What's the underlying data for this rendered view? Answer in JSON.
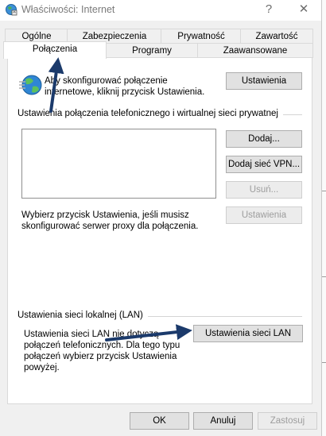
{
  "window": {
    "title": "Właściwości: Internet",
    "help_glyph": "?",
    "close_glyph": "✕"
  },
  "tabs": {
    "row1": [
      "Ogólne",
      "Zabezpieczenia",
      "Prywatność",
      "Zawartość"
    ],
    "row2": [
      "Połączenia",
      "Programy",
      "Zaawansowane"
    ],
    "active": "Połączenia"
  },
  "setup": {
    "text_line1": "Aby skonfigurować połączenie",
    "text_line2": "internetowe, kliknij przycisk Ustawienia.",
    "button": "Ustawienia"
  },
  "dialup": {
    "heading": "Ustawienia połączenia telefonicznego i wirtualnej sieci prywatnej",
    "add_button": "Dodaj...",
    "add_vpn_button": "Dodaj sieć VPN...",
    "remove_button": "Usuń...",
    "settings_button": "Ustawienia",
    "proxy_line1": "Wybierz przycisk Ustawienia, jeśli musisz",
    "proxy_line2": "skonfigurować serwer proxy dla połączenia."
  },
  "lan": {
    "heading": "Ustawienia sieci lokalnej (LAN)",
    "text_line1": "Ustawienia sieci LAN nie dotyczą",
    "text_line2": "połączeń telefonicznych. Dla tego typu",
    "text_line3": "połączeń wybierz przycisk Ustawienia",
    "text_line4": "powyżej.",
    "button": "Ustawienia sieci LAN"
  },
  "footer": {
    "ok": "OK",
    "cancel": "Anuluj",
    "apply": "Zastosuj"
  },
  "colors": {
    "arrow": "#1b3a6b",
    "window_bg": "#f0f0f0",
    "panel_bg": "#ffffff"
  }
}
